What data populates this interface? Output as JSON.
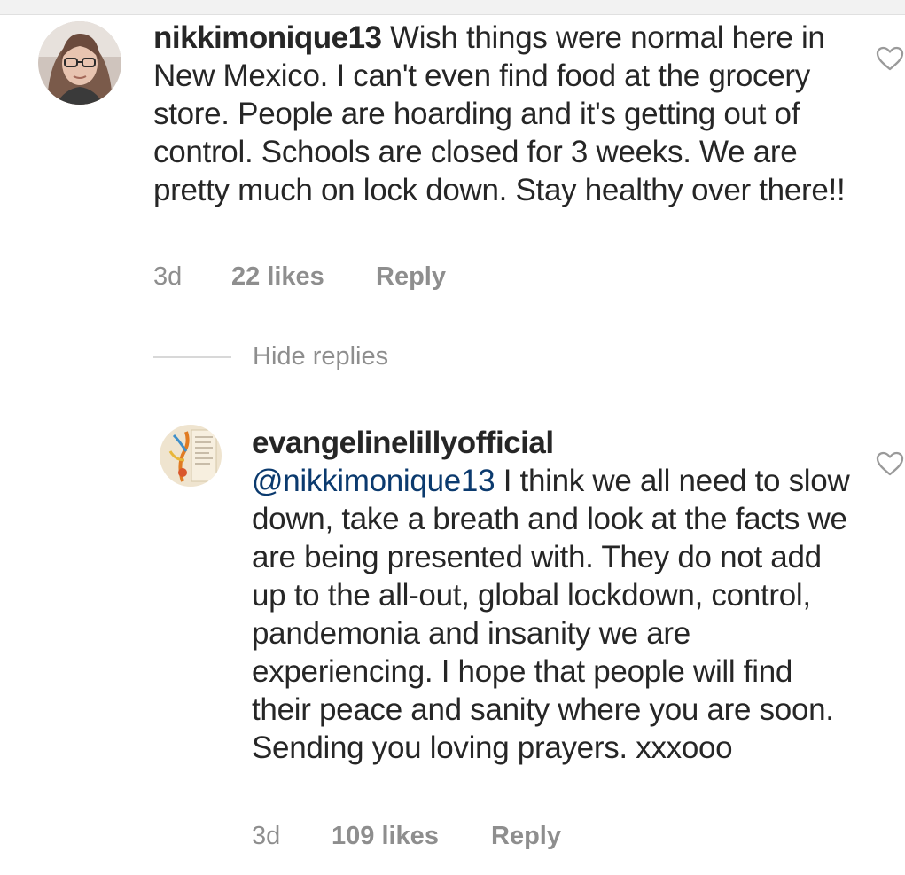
{
  "comments": [
    {
      "username": "nikkimonique13",
      "text": "Wish things were normal here in New Mexico. I can't even find food at the grocery store. People are hoarding and it's getting out of control. Schools are closed for 3 weeks. We are pretty much on lock down. Stay healthy over there!!",
      "time": "3d",
      "likes": "22 likes",
      "reply": "Reply"
    }
  ],
  "hide_replies": "Hide replies",
  "replies": [
    {
      "username": "evangelinelillyofficial",
      "mention": "@nikkimonique13",
      "text": "I think we all need to slow down, take a breath and look at the facts we are being presented with. They do not add up to the all-out, global lockdown, control, pandemonia and insanity we are experiencing. I hope that people will find their peace and sanity where you are soon.  Sending you loving prayers.  xxxooo",
      "time": "3d",
      "likes": "109 likes",
      "reply": "Reply"
    }
  ],
  "icons": {
    "like": "heart-outline-icon"
  },
  "colors": {
    "text": "#262626",
    "secondary": "#8e8e8e",
    "mention": "#0b3a6e"
  }
}
